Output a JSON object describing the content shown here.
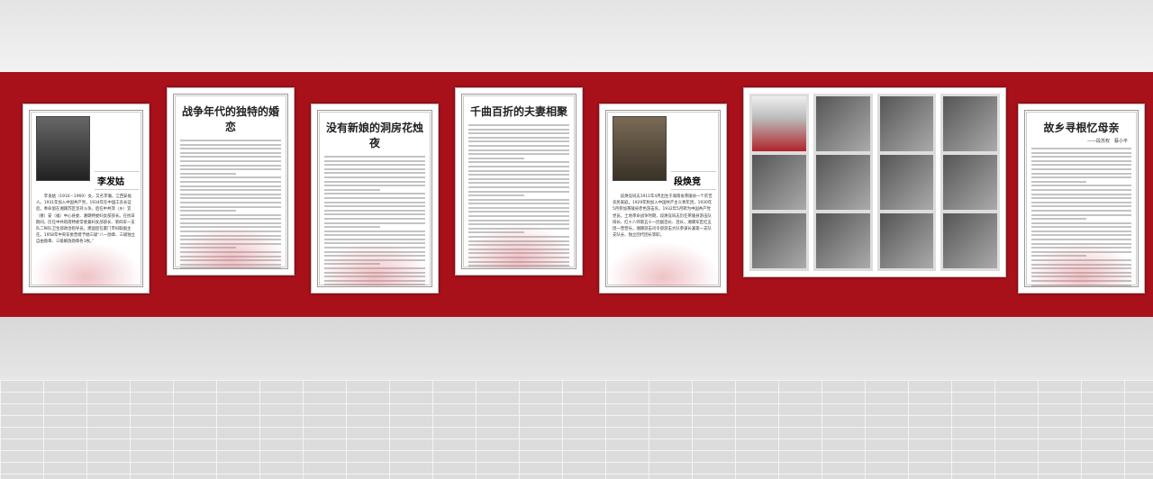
{
  "panels": [
    {
      "type": "bio",
      "name": "李发姑",
      "text": "李发姑（1916－1969）女，又名李珊，江西安福人。1931年加入中国共产党，1934年在中国工农长征后，奉命留在湘赣苏区坚持斗争。后任中共萍（乡）宜（春）安（福）中心县委、湘赣特委妇女部部长。在抗日期间，历任中共皖南特委常委兼妇女部部长、新四军一支队二纵队卫生部政治指导员。建国后任厦门市妇联副主任。1958年中央军委曾授予她三级“八一勋章、三级独立自由勋章、三级解放勋章各1枚。”"
    },
    {
      "type": "text",
      "title": "战争年代的独特的婚恋"
    },
    {
      "type": "text",
      "title": "没有新娘的洞房花烛夜"
    },
    {
      "type": "text",
      "title": "千曲百折的夫妻相聚"
    },
    {
      "type": "bio",
      "name": "段焕竞",
      "text": "段焕竞同志1911年4月出生于湖南省茶陵县一个贫苦农民家庭。1929年秋加入中国共产主义青年团，1930年5月参加茶陵县赤色游击队，1932年5月转为中国共产党党员。土地革命战争时期，段焕竞同志历任茶陵县游击队排长、红十八师第五十一团副连长、连长，湘赣军区红五团一营营长，湘赣游击司令部游击大队参谋长兼第一支队支队长、独立团代团长等职。"
    },
    {
      "type": "photos"
    },
    {
      "type": "text",
      "title": "故乡寻根忆母亲",
      "subtitle": "——段苏权　蔡小平"
    }
  ]
}
